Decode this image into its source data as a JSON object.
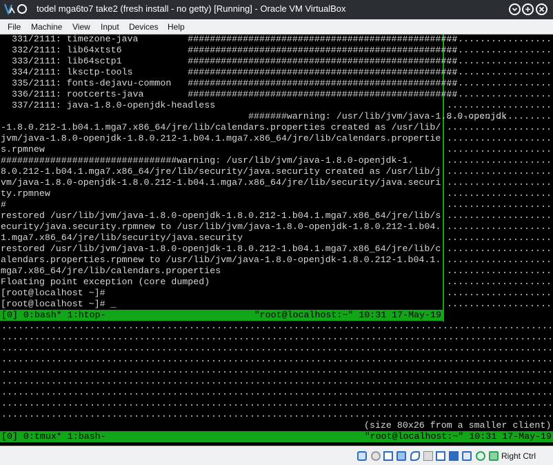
{
  "window": {
    "title": "todel mga6to7 take2 (fresh install - no getty) [Running] - Oracle VM VirtualBox",
    "buttons": [
      "minimize",
      "maximize",
      "close"
    ]
  },
  "menubar": {
    "items": [
      "File",
      "Machine",
      "View",
      "Input",
      "Devices",
      "Help"
    ]
  },
  "terminal": {
    "lines": [
      "  331/2111: timezone-java         #################################################",
      "  332/2111: lib64xtst6            #################################################",
      "  333/2111: lib64sctp1            #################################################",
      "  334/2111: lksctp-tools          #################################################",
      "  335/2111: fonts-dejavu-common   #################################################",
      "  336/2111: rootcerts-java        #################################################",
      "  337/2111: java-1.8.0-openjdk-headless",
      "                                             #######warning: /usr/lib/jvm/java-1.8.0-openjdk",
      "-1.8.0.212-1.b04.1.mga7.x86_64/jre/lib/calendars.properties created as /usr/lib/",
      "jvm/java-1.8.0-openjdk-1.8.0.212-1.b04.1.mga7.x86_64/jre/lib/calendars.propertie",
      "s.rpmnew",
      "################################warning: /usr/lib/jvm/java-1.8.0-openjdk-1.",
      "8.0.212-1.b04.1.mga7.x86_64/jre/lib/security/java.security created as /usr/lib/j",
      "vm/java-1.8.0-openjdk-1.8.0.212-1.b04.1.mga7.x86_64/jre/lib/security/java.securi",
      "ty.rpmnew",
      "#",
      "restored /usr/lib/jvm/java-1.8.0-openjdk-1.8.0.212-1.b04.1.mga7.x86_64/jre/lib/s",
      "ecurity/java.security.rpmnew to /usr/lib/jvm/java-1.8.0-openjdk-1.8.0.212-1.b04.",
      "1.mga7.x86_64/jre/lib/security/java.security",
      "restored /usr/lib/jvm/java-1.8.0-openjdk-1.8.0.212-1.b04.1.mga7.x86_64/jre/lib/c",
      "alendars.properties.rpmnew to /usr/lib/jvm/java-1.8.0-openjdk-1.8.0.212-1.b04.1.",
      "mga7.x86_64/jre/lib/calendars.properties",
      "Floating point exception (core dumped)",
      "[root@localhost ~]#",
      "[root@localhost ~]# _"
    ],
    "inner_status_left": "[0] 0:bash* 1:htop-",
    "inner_status_right": "\"root@localhost:~\" 10:31 17-May-19",
    "size_note": "(size 80x26 from a smaller client)",
    "outer_status_left": "[0] 0:tmux* 1:bash-",
    "outer_status_right": "\"root@localhost:~\" 10:31 17-May-19",
    "colors": {
      "tmux_green": "#11a618",
      "text": "#d7d7d7",
      "background": "#000000"
    }
  },
  "vbox_status": {
    "icons": [
      "hard-disk-icon",
      "optical-disk-icon",
      "audio-icon",
      "network-icon",
      "usb-icon",
      "shared-folders-icon",
      "display-icon",
      "video-capture-icon",
      "virtualization-icon",
      "mouse-integration-icon",
      "keyboard-capture-icon"
    ],
    "host_key": "Right Ctrl"
  }
}
